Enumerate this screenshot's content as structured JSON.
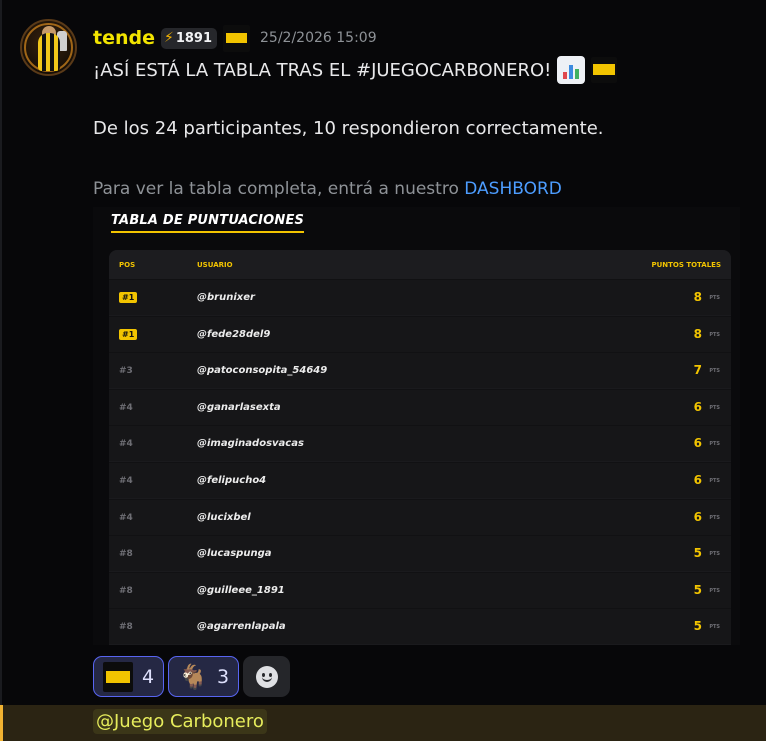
{
  "author": {
    "username": "tende",
    "tag_badge": "1891",
    "timestamp": "25/2/2026 15:09"
  },
  "message": {
    "line1": "¡ASÍ ESTÁ LA TABLA TRAS EL #JUEGOCARBONERO!",
    "line2": "De los 24 participantes, 10 respondieron correctamente.",
    "line3_prefix": "Para ver la tabla completa, entrá a nuestro ",
    "line3_link": "DASHBORD"
  },
  "embed": {
    "title": "TABLA DE PUNTUACIONES",
    "headers": {
      "pos": "POS",
      "user": "USUARIO",
      "pts": "PUNTOS TOTALES"
    },
    "points_label": "PTS",
    "rows": [
      {
        "pos": "#1",
        "user": "@brunixer",
        "points": "8",
        "highlight": true
      },
      {
        "pos": "#1",
        "user": "@fede28del9",
        "points": "8",
        "highlight": true
      },
      {
        "pos": "#3",
        "user": "@patoconsopita_54649",
        "points": "7",
        "highlight": false
      },
      {
        "pos": "#4",
        "user": "@ganarlasexta",
        "points": "6",
        "highlight": false
      },
      {
        "pos": "#4",
        "user": "@imaginadosvacas",
        "points": "6",
        "highlight": false
      },
      {
        "pos": "#4",
        "user": "@felipucho4",
        "points": "6",
        "highlight": false
      },
      {
        "pos": "#4",
        "user": "@lucixbel",
        "points": "6",
        "highlight": false
      },
      {
        "pos": "#8",
        "user": "@lucaspunga",
        "points": "5",
        "highlight": false
      },
      {
        "pos": "#8",
        "user": "@guilleee_1891",
        "points": "5",
        "highlight": false
      },
      {
        "pos": "#8",
        "user": "@agarrenlapala",
        "points": "5",
        "highlight": false
      }
    ]
  },
  "reactions": [
    {
      "icon": "juego-carbonero-logo-icon",
      "count": "4"
    },
    {
      "icon": "goat-icon",
      "count": "3"
    }
  ],
  "mention": "@Juego Carbonero",
  "colors": {
    "username": "#f2e400",
    "accent_gold": "#f2c400",
    "link": "#4d9dff",
    "reaction_border": "#5865f2",
    "mention_accent": "#f0b232"
  }
}
